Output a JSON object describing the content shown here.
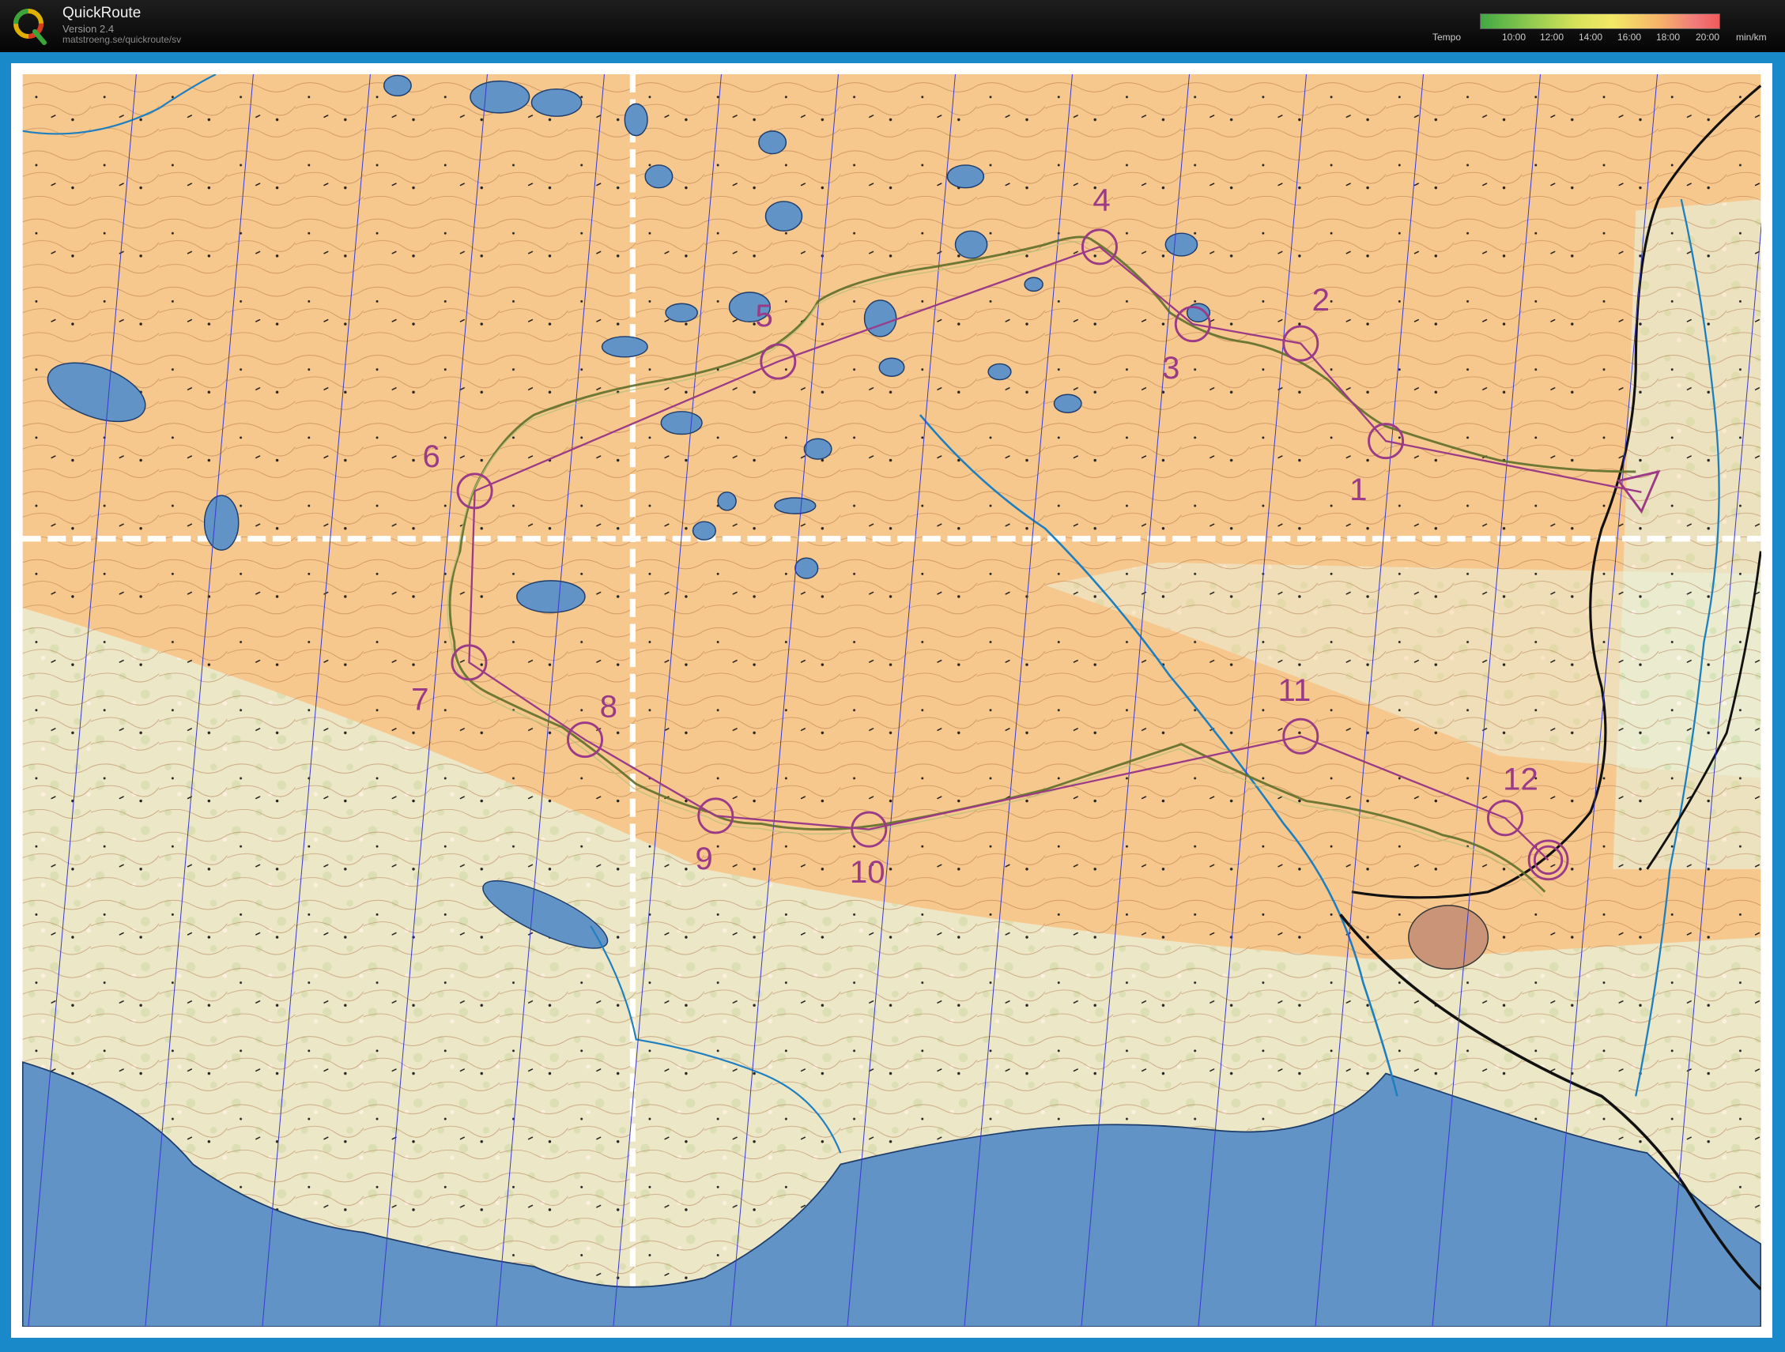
{
  "app": {
    "title": "QuickRoute",
    "version": "Version 2.4",
    "url": "matstroeng.se/quickroute/sv"
  },
  "tempo_legend": {
    "label": "Tempo",
    "ticks": [
      "10:00",
      "12:00",
      "14:00",
      "16:00",
      "18:00",
      "20:00"
    ],
    "unit": "min/km"
  },
  "course": {
    "controls": [
      "1",
      "2",
      "3",
      "4",
      "5",
      "6",
      "7",
      "8",
      "9",
      "10",
      "11",
      "12"
    ]
  },
  "colors": {
    "frame": "#1a89c9",
    "terrain": "#f7c88e",
    "vegetation": "#d9efcf",
    "water": "#6193c6",
    "course_purple": "#9b3a86",
    "route": "#7a8a3a",
    "stream": "#1e7fc0"
  }
}
